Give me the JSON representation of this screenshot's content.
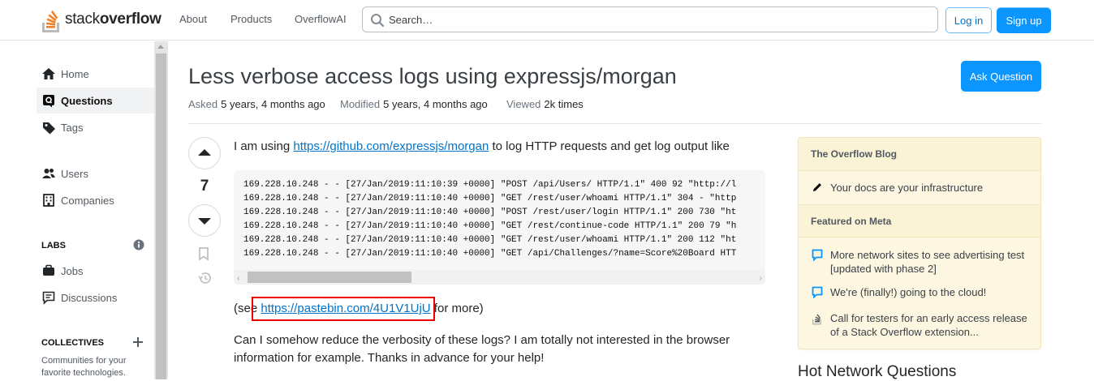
{
  "header": {
    "logo_text_light": "stack",
    "logo_text_bold": "overflow",
    "nav": [
      "About",
      "Products",
      "OverflowAI"
    ],
    "search_placeholder": "Search…",
    "login_label": "Log in",
    "signup_label": "Sign up"
  },
  "leftnav": {
    "home": "Home",
    "questions": "Questions",
    "tags": "Tags",
    "users": "Users",
    "companies": "Companies",
    "labs_heading": "LABS",
    "jobs": "Jobs",
    "discussions": "Discussions",
    "collectives_heading": "COLLECTIVES",
    "collectives_sub": "Communities for your favorite technologies."
  },
  "question": {
    "title": "Less verbose access logs using expressjs/morgan",
    "ask_label": "Ask Question",
    "asked_key": "Asked",
    "asked_value": "5 years, 4 months ago",
    "modified_key": "Modified",
    "modified_value": "5 years, 4 months ago",
    "viewed_key": "Viewed",
    "viewed_value": "2k times",
    "votes": "7",
    "intro_before": "I am using ",
    "intro_link": "https://github.com/expressjs/morgan",
    "intro_after": " to log HTTP requests and get log output like",
    "code_lines": [
      "169.228.10.248 - - [27/Jan/2019:11:10:39 +0000] \"POST /api/Users/ HTTP/1.1\" 400 92 \"http://l",
      "169.228.10.248 - - [27/Jan/2019:11:10:40 +0000] \"GET /rest/user/whoami HTTP/1.1\" 304 - \"http",
      "169.228.10.248 - - [27/Jan/2019:11:10:40 +0000] \"POST /rest/user/login HTTP/1.1\" 200 730 \"ht",
      "169.228.10.248 - - [27/Jan/2019:11:10:40 +0000] \"GET /rest/continue-code HTTP/1.1\" 200 79 \"h",
      "169.228.10.248 - - [27/Jan/2019:11:10:40 +0000] \"GET /rest/user/whoami HTTP/1.1\" 200 112 \"ht",
      "169.228.10.248 - - [27/Jan/2019:11:10:40 +0000] \"GET /api/Challenges/?name=Score%20Board HTT"
    ],
    "see_before": "(see ",
    "see_link": "https://pastebin.com/4U1V1UjU",
    "see_after": " for more)",
    "body_line1": "Can I somehow reduce the verbosity of these logs? I am totally not interested in the browser",
    "body_line2": "information for example. Thanks in advance for your help!"
  },
  "sidebar": {
    "blog_heading": "The Overflow Blog",
    "blog_item": "Your docs are your infrastructure",
    "meta_heading": "Featured on Meta",
    "meta_items": [
      "More network sites to see advertising test [updated with phase 2]",
      "We're (finally!) going to the cloud!",
      "Call for testers for an early access release of a Stack Overflow extension..."
    ],
    "hot_heading": "Hot Network Questions"
  },
  "colors": {
    "accent": "#0a95ff",
    "link": "#0074cc",
    "logo_orange": "#f48024",
    "highlight_box": "#e00000"
  }
}
